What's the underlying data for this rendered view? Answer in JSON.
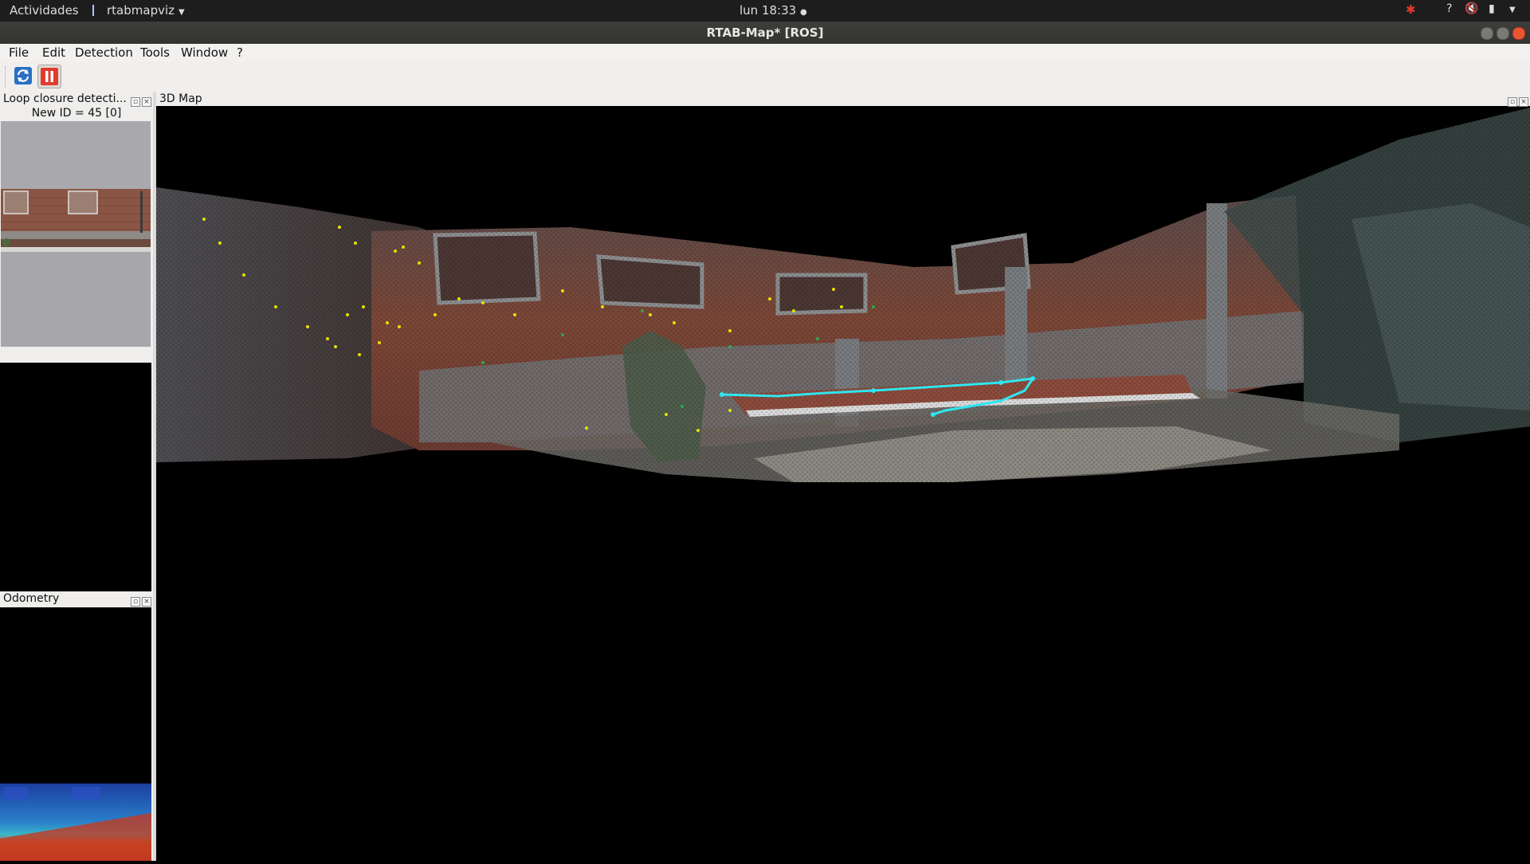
{
  "topbar": {
    "activities": "Actividades",
    "app_menu": "rtabmapviz",
    "clock": "lun 18:33",
    "tray_icons": [
      "ros-icon",
      "help-icon",
      "volume-mute-icon",
      "battery-icon",
      "system-menu-icon"
    ]
  },
  "window": {
    "title": "RTAB-Map* [ROS]"
  },
  "menu": {
    "items": [
      "File",
      "Edit",
      "Detection",
      "Tools",
      "Window",
      "?"
    ]
  },
  "toolbar": {
    "buttons": [
      "refresh-icon",
      "pause-icon"
    ]
  },
  "docks": {
    "loop_closure": {
      "title": "Loop closure detecti...",
      "info": "New ID = 45 [0]"
    },
    "odometry": {
      "title": "Odometry"
    },
    "map3d": {
      "title": "3D Map"
    }
  },
  "colors": {
    "trajectory": "#2ee6f0",
    "features_yellow": "#e8e000",
    "features_green": "#2ea84a",
    "brick": "#7a4636"
  }
}
